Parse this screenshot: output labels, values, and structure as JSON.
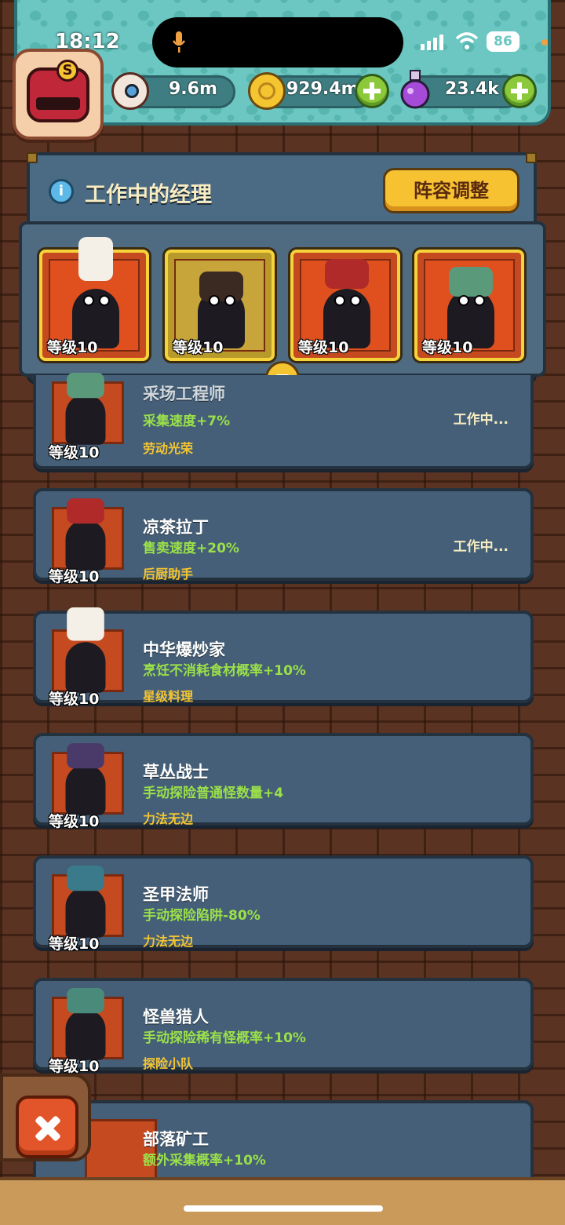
{
  "status": {
    "time": "18:12",
    "battery": "86"
  },
  "resources": [
    {
      "icon": "eyeball-icon",
      "value": "9.6m"
    },
    {
      "icon": "gold-coin-icon",
      "value": "929.4m"
    },
    {
      "icon": "purple-potion-icon",
      "value": "23.4k"
    }
  ],
  "panel": {
    "title": "工作中的经理",
    "lineup_button": "阵容调整"
  },
  "working": [
    {
      "level": "等级10"
    },
    {
      "level": "等级10"
    },
    {
      "level": "等级10"
    },
    {
      "level": "等级10"
    }
  ],
  "managers": [
    {
      "name": "采场工程师",
      "effect": "采集速度+7%",
      "tag": "劳动光荣",
      "status": "工作中...",
      "level": "等级10"
    },
    {
      "name": "凉茶拉丁",
      "effect": "售卖速度+20%",
      "tag": "后厨助手",
      "status": "工作中...",
      "level": "等级10"
    },
    {
      "name": "中华爆炒家",
      "effect": "烹饪不消耗食材概率+10%",
      "tag": "星级料理",
      "status": "",
      "level": "等级10"
    },
    {
      "name": "草丛战士",
      "effect": "手动探险普通怪数量+4",
      "tag": "力法无边",
      "status": "",
      "level": "等级10"
    },
    {
      "name": "圣甲法师",
      "effect": "手动探险陷阱-80%",
      "tag": "力法无边",
      "status": "",
      "level": "等级10"
    },
    {
      "name": "怪兽猎人",
      "effect": "手动探险稀有怪概率+10%",
      "tag": "探险小队",
      "status": "",
      "level": "等级10"
    },
    {
      "name": "部落矿工",
      "effect": "额外采集概率+10%",
      "tag": "",
      "status": "",
      "level": ""
    }
  ],
  "colors": {
    "accent": "#f5c531",
    "effect": "#9be04a",
    "panel": "#4b6b84",
    "topbar": "#6cc7c2"
  }
}
